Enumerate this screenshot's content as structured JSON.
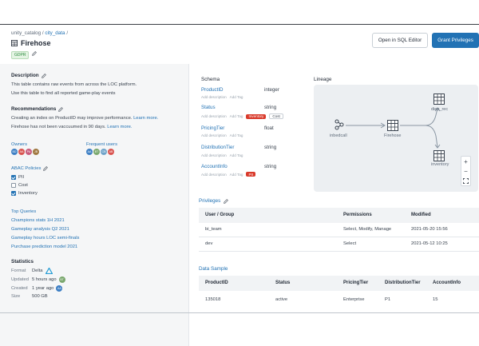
{
  "breadcrumb": {
    "catalog": "unity_catalog",
    "schema": "city_data",
    "sep": "/"
  },
  "table_title": "Firehose",
  "tags": {
    "gdpr": "GDPR"
  },
  "buttons": {
    "open_sql": "Open in SQL Editor",
    "grant": "Grant Privileges"
  },
  "description": {
    "heading": "Description",
    "line1": "This table contains raw events from across the LOC platform.",
    "line2": "Use this table to find all reported game-play events"
  },
  "recommendations": {
    "heading": "Recommendations",
    "line1": "Creating an index on ProductID may improve performance.",
    "line1_link": "Learn more.",
    "line2": "Firehose has not been vaccuumed in 90 days.",
    "line2_link": "Learn more."
  },
  "owners": {
    "heading": "Owners",
    "avatars": [
      "BD",
      "AA",
      "PA",
      "JB"
    ]
  },
  "frequent_users": {
    "heading": "Frequent users",
    "avatars": [
      "AA",
      "BT",
      "CB",
      "AB"
    ]
  },
  "abac": {
    "heading": "ABAC Policies",
    "items": [
      {
        "label": "PII",
        "checked": true
      },
      {
        "label": "Cost",
        "checked": false
      },
      {
        "label": "Inventory",
        "checked": true
      }
    ]
  },
  "top_queries": {
    "heading": "Top Queries",
    "items": [
      "Champions stats 1H 2021",
      "Gameplay analysis Q2 2021",
      "Gameplay hours LOC semi-finals",
      "Purchase prediction model 2021"
    ]
  },
  "statistics": {
    "heading": "Statistics",
    "rows": [
      {
        "key": "Format",
        "value": "Delta",
        "extra": "delta-icon"
      },
      {
        "key": "Updated",
        "value": "5 hours ago",
        "extra": "BT"
      },
      {
        "key": "Created",
        "value": "1 year ago",
        "extra": "AA"
      },
      {
        "key": "Size",
        "value": "500 GB",
        "extra": ""
      }
    ]
  },
  "schema": {
    "heading": "Schema",
    "add_description": "Add description",
    "add_tag": "Add Tag",
    "fields": [
      {
        "name": "ProductID",
        "type": "integer",
        "tags": []
      },
      {
        "name": "Status",
        "type": "string",
        "tags": [
          {
            "label": "Inventory",
            "style": "red"
          },
          {
            "label": "Cost",
            "style": "white"
          }
        ]
      },
      {
        "name": "PricingTier",
        "type": "float",
        "tags": []
      },
      {
        "name": "DistributionTier",
        "type": "string",
        "tags": []
      },
      {
        "name": "AccountInfo",
        "type": "string",
        "tags": [
          {
            "label": "PII",
            "style": "red"
          }
        ]
      }
    ]
  },
  "lineage": {
    "heading": "Lineage",
    "nodes": {
      "source": "inbedcall",
      "center": "Firehose",
      "top": "diep_rec",
      "bottom": "inventory"
    },
    "zoom": {
      "in": "+",
      "out": "−"
    }
  },
  "privileges": {
    "heading": "Privileges",
    "columns": [
      "User / Group",
      "Permissions",
      "Modified"
    ],
    "rows": [
      [
        "bi_team",
        "Select, Modify, Manage",
        "2021-05-20 15:56"
      ],
      [
        "dev",
        "Select",
        "2021-05-12 10:25"
      ]
    ]
  },
  "data_sample": {
    "heading": "Data Sample",
    "columns": [
      "ProductID",
      "Status",
      "PricingTier",
      "DistributionTier",
      "AccountInfo"
    ],
    "rows": [
      [
        "135018",
        "active",
        "Enterprise",
        "P1",
        "15"
      ]
    ]
  },
  "colors": {
    "accent": "#2272b4",
    "danger": "#d93a2b",
    "success": "#2b8a3e"
  }
}
